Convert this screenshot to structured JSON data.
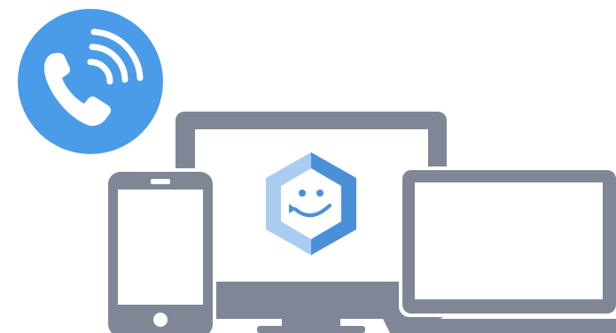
{
  "illustration": {
    "icons": [
      "phone-call-icon",
      "desktop-monitor-icon",
      "smartphone-icon",
      "laptop-icon",
      "smiley-hexagon-logo"
    ]
  },
  "colors": {
    "phone_badge": "#4a9be8",
    "device_gray": "#7f8797",
    "screen": "#ffffff",
    "logo_dark": "#4a90d9",
    "logo_light": "#a9cdf1",
    "logo_inner": "#4a90d9"
  }
}
